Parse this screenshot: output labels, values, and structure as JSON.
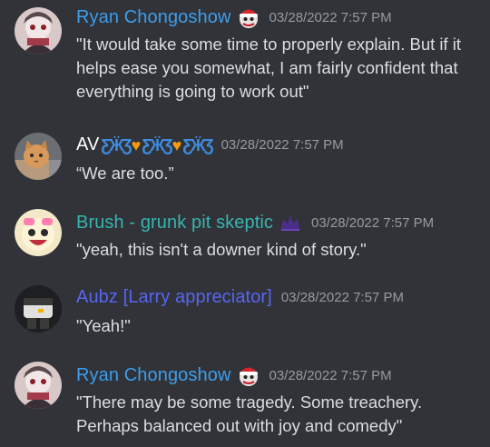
{
  "colors": {
    "background": "#313338",
    "text": "#dbdee1",
    "timestamp": "#949ba4",
    "ryan": "#3b9eee",
    "av": "#ffffff",
    "brush": "#36b5b0",
    "aubz": "#5865f2"
  },
  "messages": [
    {
      "username": "Ryan Chongoshow",
      "badge_icon": "clown-santa-icon",
      "timestamp": "03/28/2022 7:57 PM",
      "text": "\"It would take some time to properly explain. But if it helps ease you somewhat, I am fairly confident that everything is going to work out\""
    },
    {
      "username": "AV",
      "badge_icon": "butterfly-heart-icons",
      "timestamp": "03/28/2022 7:57 PM",
      "text": "“We are too.”"
    },
    {
      "username": "Brush - grunk pit skeptic",
      "badge_icon": "purple-crown-icon",
      "timestamp": "03/28/2022 7:57 PM",
      "text": "\"yeah, this isn't a downer kind of story.\""
    },
    {
      "username": "Aubz [Larry appreciator]",
      "timestamp": "03/28/2022 7:57 PM",
      "text": "\"Yeah!\""
    },
    {
      "username": "Ryan Chongoshow",
      "badge_icon": "clown-santa-icon",
      "timestamp": "03/28/2022 7:57 PM",
      "text": "\"There may be some tragedy. Some treachery. Perhaps balanced out with joy and comedy\""
    }
  ]
}
